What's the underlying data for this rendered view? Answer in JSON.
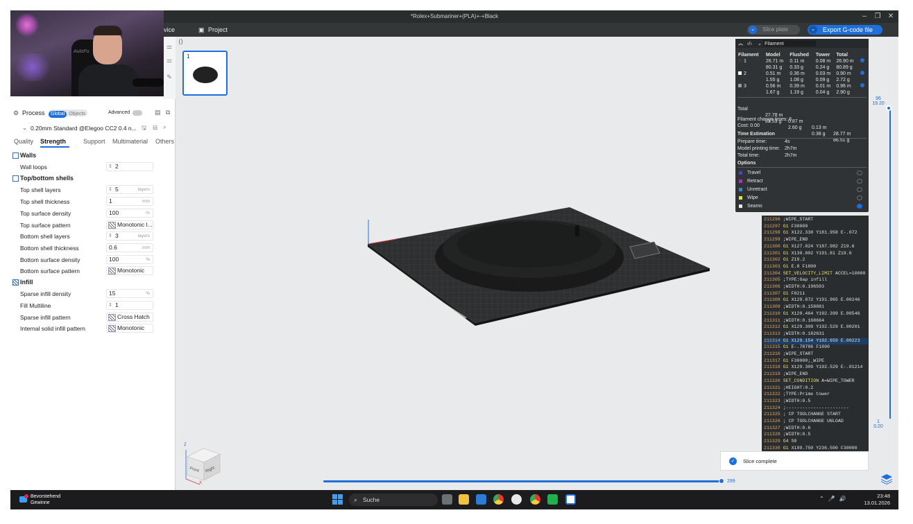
{
  "window": {
    "title": "*Rolex+Submariner+(PLA)+-+Black"
  },
  "menubar": {
    "device": "vice",
    "project": "Project",
    "slice": "Slice plate",
    "export": "Export G-code file"
  },
  "webcam": {
    "brand": "AutoFu"
  },
  "process": {
    "title": "Process",
    "toggle_global": "Global",
    "toggle_objects": "Objects",
    "advanced": "Advanced",
    "preset": "0.20mm Standard @Elegoo CC2 0.4 n...",
    "tabs": [
      "Quality",
      "Strength",
      "Support",
      "Multimaterial",
      "Others"
    ],
    "active_tab": "Strength",
    "sections": {
      "walls": "Walls",
      "shells": "Top/bottom shells",
      "infill": "Infill"
    },
    "settings": {
      "wall_loops": {
        "label": "Wall loops",
        "value": "2"
      },
      "top_shell_layers": {
        "label": "Top shell layers",
        "value": "5",
        "unit": "layers"
      },
      "top_shell_thickness": {
        "label": "Top shell thickness",
        "value": "1",
        "unit": "mm"
      },
      "top_surface_density": {
        "label": "Top surface density",
        "value": "100",
        "unit": "%"
      },
      "top_surface_pattern": {
        "label": "Top surface pattern",
        "value": "Monotonic l..."
      },
      "bottom_shell_layers": {
        "label": "Bottom shell layers",
        "value": "3",
        "unit": "layers"
      },
      "bottom_shell_thickness": {
        "label": "Bottom shell thickness",
        "value": "0.6",
        "unit": "mm"
      },
      "bottom_surface_density": {
        "label": "Bottom surface density",
        "value": "100",
        "unit": "%"
      },
      "bottom_surface_pattern": {
        "label": "Bottom surface pattern",
        "value": "Monotonic"
      },
      "sparse_infill_density": {
        "label": "Sparse infill density",
        "value": "15",
        "unit": "%"
      },
      "fill_multiline": {
        "label": "Fill Multiline",
        "value": "1"
      },
      "sparse_infill_pattern": {
        "label": "Sparse infill pattern",
        "value": "Cross Hatch"
      },
      "internal_solid_infill_pattern": {
        "label": "Internal solid infill pattern",
        "value": "Monotonic"
      }
    }
  },
  "plate": {
    "number": "1"
  },
  "filament_panel": {
    "header": "Filament",
    "columns": [
      "Filament",
      "Model",
      "Flushed",
      "Tower",
      "Total"
    ],
    "rows": [
      {
        "id": "1",
        "color": "#3a3a3a",
        "model": "26.71 m\n80.31 g",
        "flushed": "0.11 m\n0.33 g",
        "tower": "0.08 m\n0.24 g",
        "total": "26.90 m\n80.89 g"
      },
      {
        "id": "2",
        "color": "#ffffff",
        "model": "0.51 m\n1.55 g",
        "flushed": "0.36 m\n1.08 g",
        "tower": "0.03 m\n0.09 g",
        "total": "0.90 m\n2.72 g"
      },
      {
        "id": "3",
        "color": "#9a9a9a",
        "model": "0.56 m\n1.67 g",
        "flushed": "0.39 m\n1.19 g",
        "tower": "0.01 m\n0.04 g",
        "total": "0.96 m\n2.90 g"
      }
    ],
    "total": {
      "label": "Total",
      "model": "27.78 m\n83.53 g",
      "flushed": "0.87 m\n2.60 g",
      "tower": "0.13 m\n0.38 g",
      "total": "28.77 m\n86.51 g"
    },
    "change_times": "Filament change times: 6",
    "cost": "Cost: 0.00",
    "time_header": "Time Estimation",
    "prepare_label": "Prepare time:",
    "prepare_value": "4s",
    "model_label": "Model printing time:",
    "model_value": "2h7m",
    "total_label": "Total time:",
    "total_value": "2h7m",
    "options_header": "Options",
    "options": [
      {
        "label": "Travel",
        "color": "#3a4ad6",
        "on": false
      },
      {
        "label": "Retract",
        "color": "#c023c5",
        "on": false
      },
      {
        "label": "Unretract",
        "color": "#2a8cd6",
        "on": false
      },
      {
        "label": "Wipe",
        "color": "#f0e32a",
        "on": false
      },
      {
        "label": "Seams",
        "color": "#e8e8e8",
        "on": true
      }
    ]
  },
  "gcode": [
    {
      "no": "211296",
      "cmd": "",
      "rest": ";WIPE_START"
    },
    {
      "no": "211297",
      "cmd": "G1",
      "rest": " F30000"
    },
    {
      "no": "211298",
      "cmd": "G1",
      "rest": " X122.338 Y181.958 E-.072"
    },
    {
      "no": "211299",
      "cmd": "",
      "rest": ";WIPE_END"
    },
    {
      "no": "211300",
      "cmd": "G1",
      "rest": " X127.024 Y187.982 Z19.6"
    },
    {
      "no": "211301",
      "cmd": "G1",
      "rest": " X130.002 Y191.81 Z19.6"
    },
    {
      "no": "211302",
      "cmd": "G1",
      "rest": " Z19.2"
    },
    {
      "no": "211303",
      "cmd": "G1",
      "rest": " E.8 F1800"
    },
    {
      "no": "211304",
      "cmd": "SET_VELOCITY_LIMIT",
      "rest": " ACCEL=10000"
    },
    {
      "no": "211305",
      "cmd": "",
      "rest": ";TYPE:Gap infill"
    },
    {
      "no": "211306",
      "cmd": "",
      "rest": ";WIDTH:0.196593"
    },
    {
      "no": "211307",
      "cmd": "G1",
      "rest": " F8211"
    },
    {
      "no": "211308",
      "cmd": "G1",
      "rest": " X129.872 Y191.965 E.00246"
    },
    {
      "no": "211309",
      "cmd": "",
      "rest": ";WIDTH:0.158881"
    },
    {
      "no": "211310",
      "cmd": "G1",
      "rest": " X129.464 Y192.399 E.00546"
    },
    {
      "no": "211311",
      "cmd": "",
      "rest": ";WIDTH:0.168664"
    },
    {
      "no": "211312",
      "cmd": "G1",
      "rest": " X129.309 Y192.529 E.00201"
    },
    {
      "no": "211313",
      "cmd": "",
      "rest": ";WIDTH:0.182631"
    },
    {
      "no": "211314",
      "cmd": "G1",
      "rest": " X129.154 Y192.659 E.00223"
    },
    {
      "no": "211315",
      "cmd": "G1",
      "rest": " E-.78786 F1800"
    },
    {
      "no": "211316",
      "cmd": "",
      "rest": ";WIPE_START"
    },
    {
      "no": "211317",
      "cmd": "G1",
      "rest": " F30000;_WIPE"
    },
    {
      "no": "211318",
      "cmd": "G1",
      "rest": " X129.309 Y192.529 E-.01214"
    },
    {
      "no": "211319",
      "cmd": "",
      "rest": ";WIPE_END"
    },
    {
      "no": "211320",
      "cmd": "SET_CONDITION",
      "rest": " A=WIPE_TOWER"
    },
    {
      "no": "211321",
      "cmd": "",
      "rest": ";HEIGHT:0.2"
    },
    {
      "no": "211322",
      "cmd": "",
      "rest": ";TYPE:Prime tower"
    },
    {
      "no": "211323",
      "cmd": "",
      "rest": ";WIDTH:0.5"
    },
    {
      "no": "211324",
      "cmd": "",
      "rest": ";-----------------------"
    },
    {
      "no": "211325",
      "cmd": "",
      "rest": "; CP TOOLCHANGE START"
    },
    {
      "no": "211326",
      "cmd": "",
      "rest": "; CP TOOLCHANGE UNLOAD"
    },
    {
      "no": "211327",
      "cmd": "",
      "rest": ";WIDTH:0.6"
    },
    {
      "no": "211328",
      "cmd": "",
      "rest": ";WIDTH:0.5"
    },
    {
      "no": "211329",
      "cmd": "G4",
      "rest": " S0"
    },
    {
      "no": "211330",
      "cmd": "G1",
      "rest": " X199.750 Y236.500 F30000"
    },
    {
      "no": "211331",
      "cmd": "G4",
      "rest": " S0"
    }
  ],
  "layer_slider": {
    "top_layer": "96",
    "top_height": "19.20",
    "bottom_layer": "1",
    "bottom_height": "0.20"
  },
  "move_slider": {
    "value": "299"
  },
  "toast": {
    "text": "Slice complete"
  },
  "cube": {
    "front": "Front",
    "right": "Right",
    "z": "Z",
    "x": "X"
  },
  "taskbar": {
    "widget_line1": "Bevorstehend",
    "widget_line2": "Gewinne",
    "search": "Suche",
    "time": "23:48",
    "date": "13.01.2026"
  }
}
